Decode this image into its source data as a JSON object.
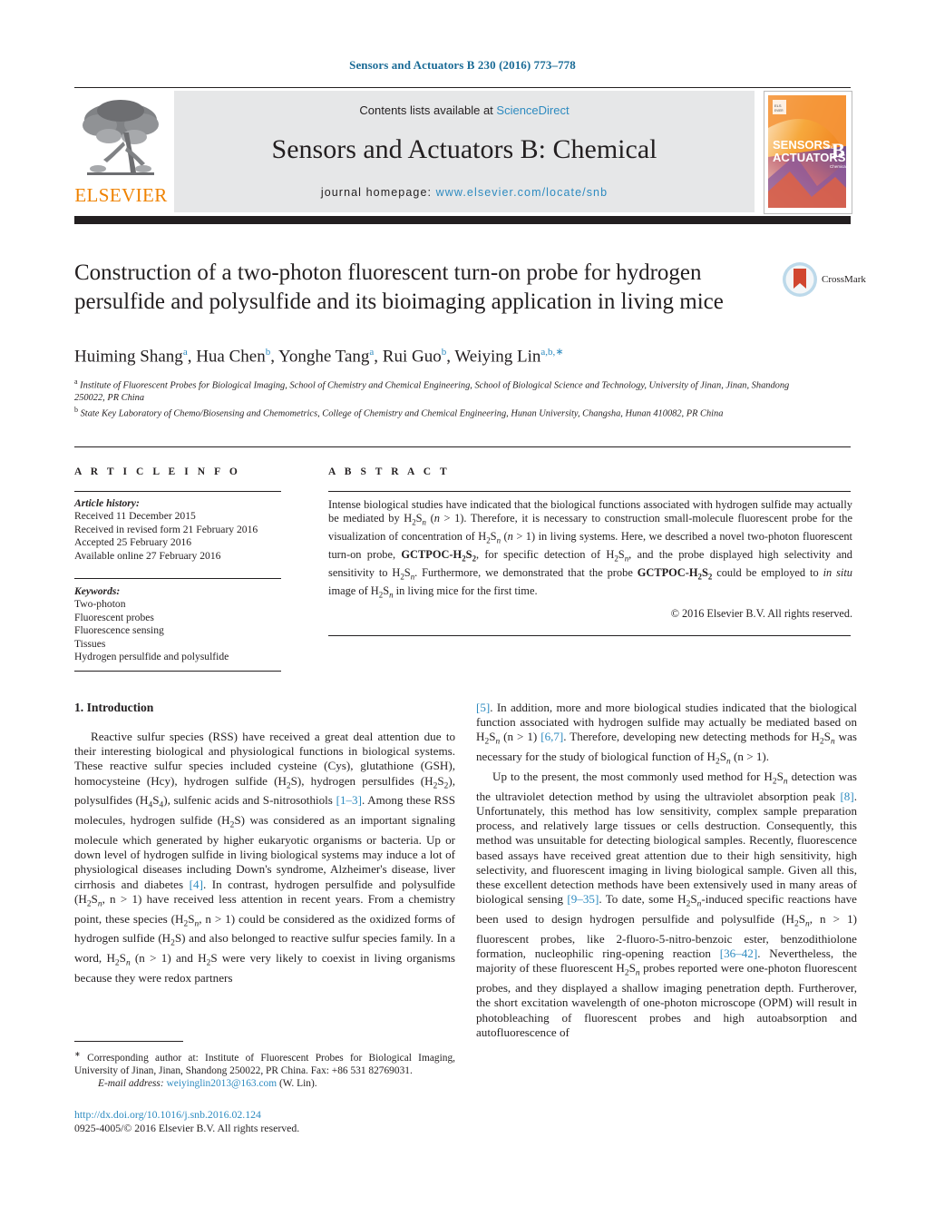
{
  "running_head": "Sensors and Actuators B 230 (2016) 773–778",
  "masthead": {
    "contents_prefix": "Contents lists available at ",
    "sciencedirect": "ScienceDirect",
    "journal_title": "Sensors and Actuators B: Chemical",
    "homepage_prefix": "journal homepage: ",
    "homepage_url": "www.elsevier.com/locate/snb",
    "publisher": "ELSEVIER",
    "cover_line1": "SENSORS",
    "cover_and": "and",
    "cover_line2": "ACTUATORS",
    "cover_letter": "B",
    "cover_sub": "Chemical",
    "accent_orange": "#ef8200",
    "accent_blue": "#2e8bc0",
    "panel_grey": "#e6e7e8"
  },
  "article": {
    "title": "Construction of a two-photon fluorescent turn-on probe for hydrogen persulfide and polysulfide and its bioimaging application in living mice",
    "crossmark_label": "CrossMark",
    "authors_html": "Huiming Shang<sup>a</sup>, Hua Chen<sup>b</sup>, Yonghe Tang<sup>a</sup>, Rui Guo<sup>b</sup>, Weiying Lin<sup>a,b,</sup><sup>∗</sup>",
    "affiliations": [
      {
        "marker": "a",
        "text": "Institute of Fluorescent Probes for Biological Imaging, School of Chemistry and Chemical Engineering, School of Biological Science and Technology, University of Jinan, Jinan, Shandong 250022, PR China"
      },
      {
        "marker": "b",
        "text": "State Key Laboratory of Chemo/Biosensing and Chemometrics, College of Chemistry and Chemical Engineering, Hunan University, Changsha, Hunan 410082, PR China"
      }
    ]
  },
  "article_info": {
    "heading": "A R T I C L E   I N F O",
    "history_label": "Article history:",
    "history": [
      "Received 11 December 2015",
      "Received in revised form 21 February 2016",
      "Accepted 25 February 2016",
      "Available online 27 February 2016"
    ],
    "keywords_label": "Keywords:",
    "keywords": [
      "Two-photon",
      "Fluorescent probes",
      "Fluorescence sensing",
      "Tissues",
      "Hydrogen persulfide and polysulfide"
    ]
  },
  "abstract": {
    "heading": "A B S T R A C T",
    "text_html": "Intense biological studies have indicated that the biological functions associated with hydrogen sulfide may actually be mediated by H<sub>2</sub>S<sub><i>n</i></sub> (<i>n</i> &gt; 1). Therefore, it is necessary to construction small-molecule fluorescent probe for the visualization of concentration of H<sub>2</sub>S<sub><i>n</i></sub> (<i>n</i> &gt; 1) in living systems. Here, we described a novel two-photon fluorescent turn-on probe, <b>GCTPOC-H<sub>2</sub>S<sub>2</sub></b>, for specific detection of H<sub>2</sub>S<sub><i>n</i></sub>, and the probe displayed high selectivity and sensitivity to H<sub>2</sub>S<sub><i>n</i></sub>. Furthermore, we demonstrated that the probe <b>GCTPOC-H<sub>2</sub>S<sub>2</sub></b> could be employed to <i>in situ</i> image of H<sub>2</sub>S<sub><i>n</i></sub> in living mice for the first time.",
    "copyright": "© 2016 Elsevier B.V. All rights reserved."
  },
  "body": {
    "section_heading": "1.  Introduction",
    "left_paragraphs_html": [
      "Reactive sulfur species (RSS) have received a great deal attention due to their interesting biological and physiological functions in biological systems. These reactive sulfur species included cysteine (Cys), glutathione (GSH), homocysteine (Hcy), hydrogen sulfide (H<sub>2</sub>S), hydrogen persulfides (H<sub>2</sub>S<sub>2</sub>), polysulfides (H<sub>4</sub>S<sub>4</sub>), sulfenic acids and S-nitrosothiols <span class=\"ref\">[1–3]</span>. Among these RSS molecules, hydrogen sulfide (H<sub>2</sub>S) was considered as an important signaling molecule which generated by higher eukaryotic organisms or bacteria. Up or down level of hydrogen sulfide in living biological systems may induce a lot of physiological diseases including Down's syndrome, Alzheimer's disease, liver cirrhosis and diabetes <span class=\"ref\">[4]</span>. In contrast, hydrogen persulfide and polysulfide (H<sub>2</sub>S<sub><i>n</i></sub>, n &gt; 1) have received less attention in recent years. From a chemistry point, these species (H<sub>2</sub>S<sub><i>n</i></sub>, n &gt; 1) could be considered as the oxidized forms of hydrogen sulfide (H<sub>2</sub>S) and also belonged to reactive sulfur species family. In a word, H<sub>2</sub>S<sub><i>n</i></sub> (n &gt; 1) and H<sub>2</sub>S were very likely to coexist in living organisms because they were redox partners"
    ],
    "right_paragraphs_html": [
      "<span class=\"ref\">[5]</span>. In addition, more and more biological studies indicated that the biological function associated with hydrogen sulfide may actually be mediated based on H<sub>2</sub>S<sub><i>n</i></sub> (n &gt; 1) <span class=\"ref\">[6,7]</span>. Therefore, developing new detecting methods for H<sub>2</sub>S<sub><i>n</i></sub> was necessary for the study of biological function of H<sub>2</sub>S<sub><i>n</i></sub> (n &gt; 1).",
      "Up to the present, the most commonly used method for H<sub>2</sub>S<sub><i>n</i></sub> detection was the ultraviolet detection method by using the ultraviolet absorption peak <span class=\"ref\">[8]</span>. Unfortunately, this method has low sensitivity, complex sample preparation process, and relatively large tissues or cells destruction. Consequently, this method was unsuitable for detecting biological samples. Recently, fluorescence based assays have received great attention due to their high sensitivity, high selectivity, and fluorescent imaging in living biological sample. Given all this, these excellent detection methods have been extensively used in many areas of biological sensing <span class=\"ref\">[9–35]</span>. To date, some H<sub>2</sub>S<sub><i>n</i></sub>-induced specific reactions have been used to design hydrogen persulfide and polysulfide (H<sub>2</sub>S<sub><i>n</i></sub>, n &gt; 1) fluorescent probes, like 2-fluoro-5-nitro-benzoic ester, benzodithiolone formation, nucleophilic ring-opening reaction <span class=\"ref\">[36–42]</span>. Nevertheless, the majority of these fluorescent H<sub>2</sub>S<sub><i>n</i></sub> probes reported were one-photon fluorescent probes, and they displayed a shallow imaging penetration depth. Furtherover, the short excitation wavelength of one-photon microscope (OPM) will result in photobleaching of fluorescent probes and high autoabsorption and autofluorescence of"
    ]
  },
  "footer": {
    "corresponding_html": "<sup class=\"note\">∗</sup> Corresponding author at: Institute of Fluorescent Probes for Biological Imaging, University of Jinan, Jinan, Shandong 250022, PR China. Fax: +86 531 82769031.",
    "email_label": "E-mail address:",
    "email": "weiyinglin2013@163.com",
    "email_suffix": "(W. Lin).",
    "doi_url": "http://dx.doi.org/10.1016/j.snb.2016.02.124",
    "issn_line": "0925-4005/© 2016 Elsevier B.V. All rights reserved."
  }
}
